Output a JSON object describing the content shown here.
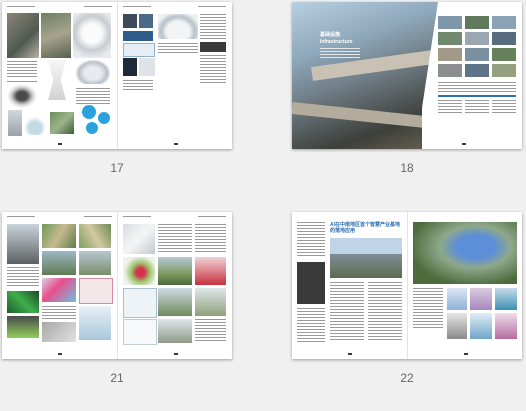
{
  "pages": [
    {
      "label": "17"
    },
    {
      "label": "18",
      "title_cn": "基础设施",
      "title_en": "Infrastructure"
    },
    {
      "label": "21"
    },
    {
      "label": "22",
      "title_cn": "AI在中南地区首个智慧产业基地的落地应用"
    }
  ],
  "colors": {
    "background": "#f0f0f0",
    "accent_blue": "#2aa3dc",
    "heading_blue": "#2a6fb0"
  }
}
